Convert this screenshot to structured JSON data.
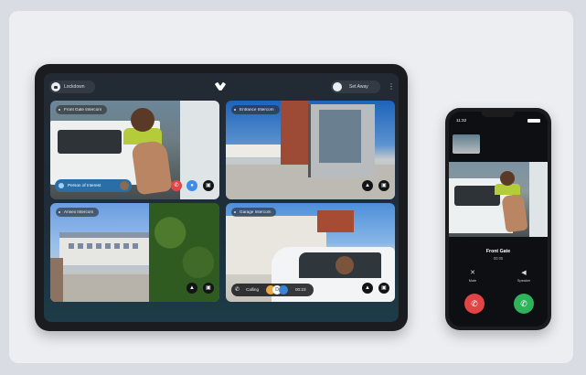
{
  "tablet": {
    "lockdown_label": "Lockdown",
    "set_away_label": "Set Away",
    "more_glyph": "⋮",
    "cameras": [
      {
        "label": "Front Gate Intercom"
      },
      {
        "label": "Entrance Intercom"
      },
      {
        "label": "Annex Intercom"
      },
      {
        "label": "Garage Intercom"
      }
    ],
    "person_of_interest_label": "Person of Interest",
    "calling_label": "Calling",
    "calling_timer": "00:23",
    "calling_avatar_letter": "D"
  },
  "phone": {
    "time": "11:32",
    "caller_name": "Front Gate",
    "call_timer": "00:05",
    "mute_label": "Mute",
    "speaker_label": "Speaker"
  },
  "colors": {
    "end_call": "#e14444",
    "answer": "#2fb35a",
    "accent_blue": "#3d8ce8"
  },
  "icons": [
    "lock-icon",
    "logo-icon",
    "shield-icon",
    "kebab-icon",
    "lock-icon",
    "siren-icon",
    "phone-hangup-icon",
    "microphone-icon",
    "mute-icon",
    "speaker-icon",
    "phone-answer-icon"
  ]
}
